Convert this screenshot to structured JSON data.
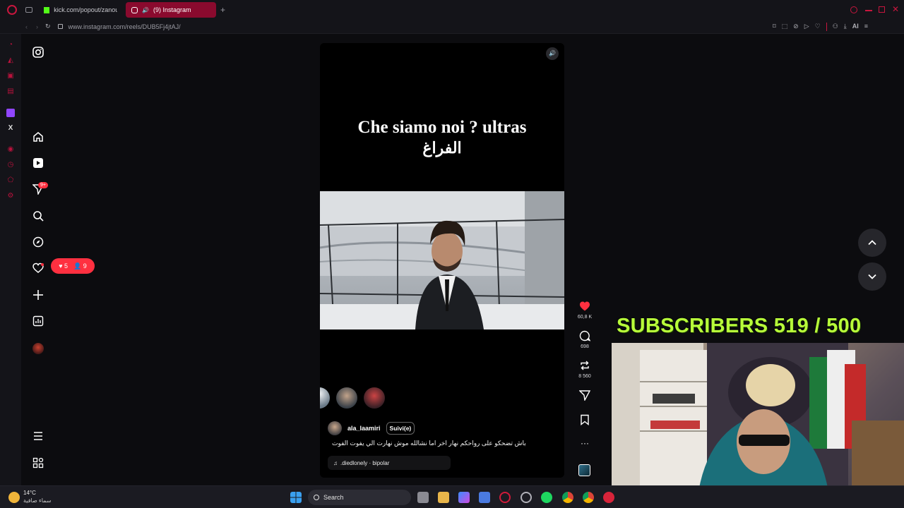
{
  "browser": {
    "tabs": [
      {
        "title": "kick.com/popout/zanoun/",
        "active": false
      },
      {
        "title": "(9) Instagram",
        "active": true
      }
    ],
    "url": "www.instagram.com/reels/DUB5Fj4jtAJ/",
    "ai_label": "AI"
  },
  "instagram": {
    "sidebar": {
      "messages_badge": "9+",
      "notifications": {
        "likes": "5",
        "follows": "9"
      }
    },
    "reel": {
      "overlay_title": "Che siamo noi ? ultras",
      "overlay_subtitle": "الفراغ",
      "username": "ala_laamiri",
      "follow_label": "Suivi(e)",
      "caption": "باش تضحكو على رواحكم نهار اخر اما نشالله موش نهارت الي يفوت الفوت",
      "audio": ".diedlonely · bipolar",
      "likes": "60,8 K",
      "comments": "698",
      "reposts": "8 560"
    }
  },
  "stream": {
    "subs_text": "SUBSCRIBERS 519 / 500"
  },
  "taskbar": {
    "weather_temp": "14°C",
    "weather_desc": "سماء صافية",
    "search_label": "Search"
  },
  "colors": {
    "accent": "#b8123c",
    "tab_active": "#8a0a2e",
    "like_red": "#ff3040",
    "subs_green": "#b8ff3a"
  }
}
